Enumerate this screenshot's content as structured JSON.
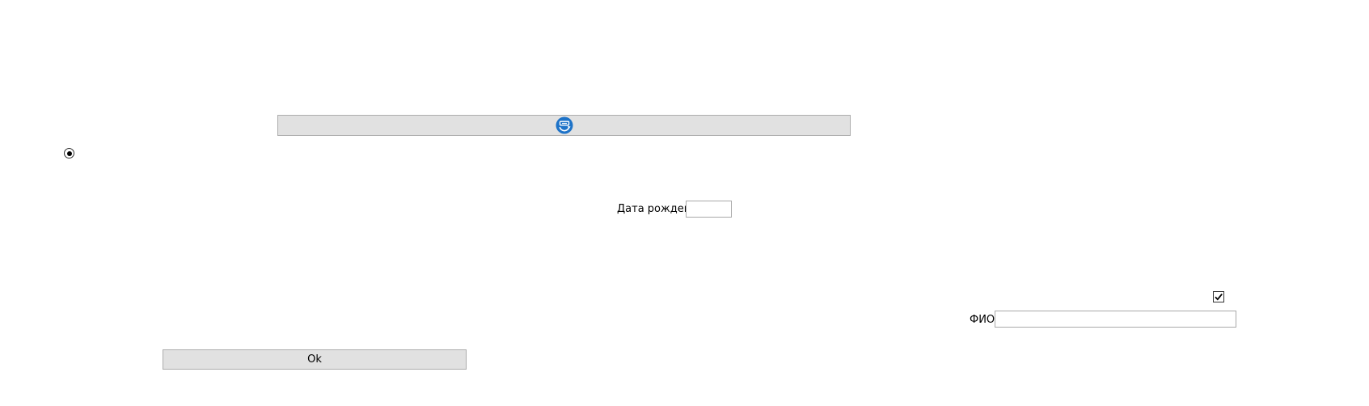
{
  "icon_button": {
    "icon": "refresh-badge-icon",
    "color": "#1e73c8"
  },
  "radio": {
    "checked": true
  },
  "birth_date": {
    "label": "Дата рождения",
    "value": ""
  },
  "checkbox": {
    "checked": true
  },
  "full_name": {
    "label": "ФИО",
    "value": ""
  },
  "ok_button": {
    "label": "Ok"
  }
}
